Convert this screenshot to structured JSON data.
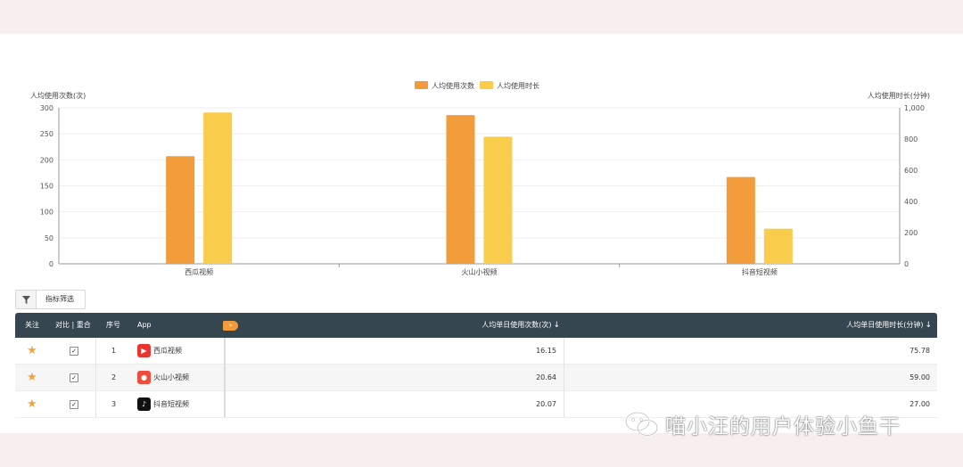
{
  "chart_data": {
    "type": "bar",
    "categories": [
      "西瓜视频",
      "火山小视频",
      "抖音短视频"
    ],
    "series": [
      {
        "name": "人均使用次数",
        "axis": "left",
        "color": "#f39c3c",
        "values": [
          207,
          286,
          167
        ]
      },
      {
        "name": "人均使用时长",
        "axis": "right",
        "color": "#f9cc4b",
        "values": [
          970,
          815,
          225
        ]
      }
    ],
    "ylabel": "人均使用次数(次)",
    "ylabel_right": "人均使用时长(分钟)",
    "ylim": [
      0,
      300
    ],
    "ylim_right": [
      0,
      1000
    ],
    "yticks": [
      "0",
      "50",
      "100",
      "150",
      "200",
      "250",
      "300"
    ],
    "yticks_right": [
      "0",
      "200",
      "400",
      "600",
      "800",
      "1,000"
    ],
    "legend_position": "top-center",
    "grid": true
  },
  "filter": {
    "icon": "filter-icon",
    "label": "指标筛选"
  },
  "table": {
    "headers": {
      "follow": "关注",
      "compare": "对比 | 重合",
      "index": "序号",
      "app": "App",
      "expand": "»",
      "daily_count": "人均单日使用次数(次)",
      "daily_duration": "人均单日使用时长(分钟)",
      "sort_icon": "↓"
    },
    "rows": [
      {
        "star": "★",
        "check": "✓",
        "index": "1",
        "app": "西瓜视频",
        "icon_color": "#e8352f",
        "icon_glyph": "▶",
        "daily_count": "16.15",
        "daily_duration": "75.78"
      },
      {
        "star": "★",
        "check": "✓",
        "index": "2",
        "app": "火山小视频",
        "icon_color": "#f14b3c",
        "icon_glyph": "●",
        "daily_count": "20.64",
        "daily_duration": "59.00"
      },
      {
        "star": "★",
        "check": "✓",
        "index": "3",
        "app": "抖音短视频",
        "icon_color": "#111111",
        "icon_glyph": "♪",
        "daily_count": "20.07",
        "daily_duration": "27.00"
      }
    ]
  },
  "watermark": {
    "text": "喵小汪的用户体验小鱼干",
    "icon": "wechat-icon"
  }
}
